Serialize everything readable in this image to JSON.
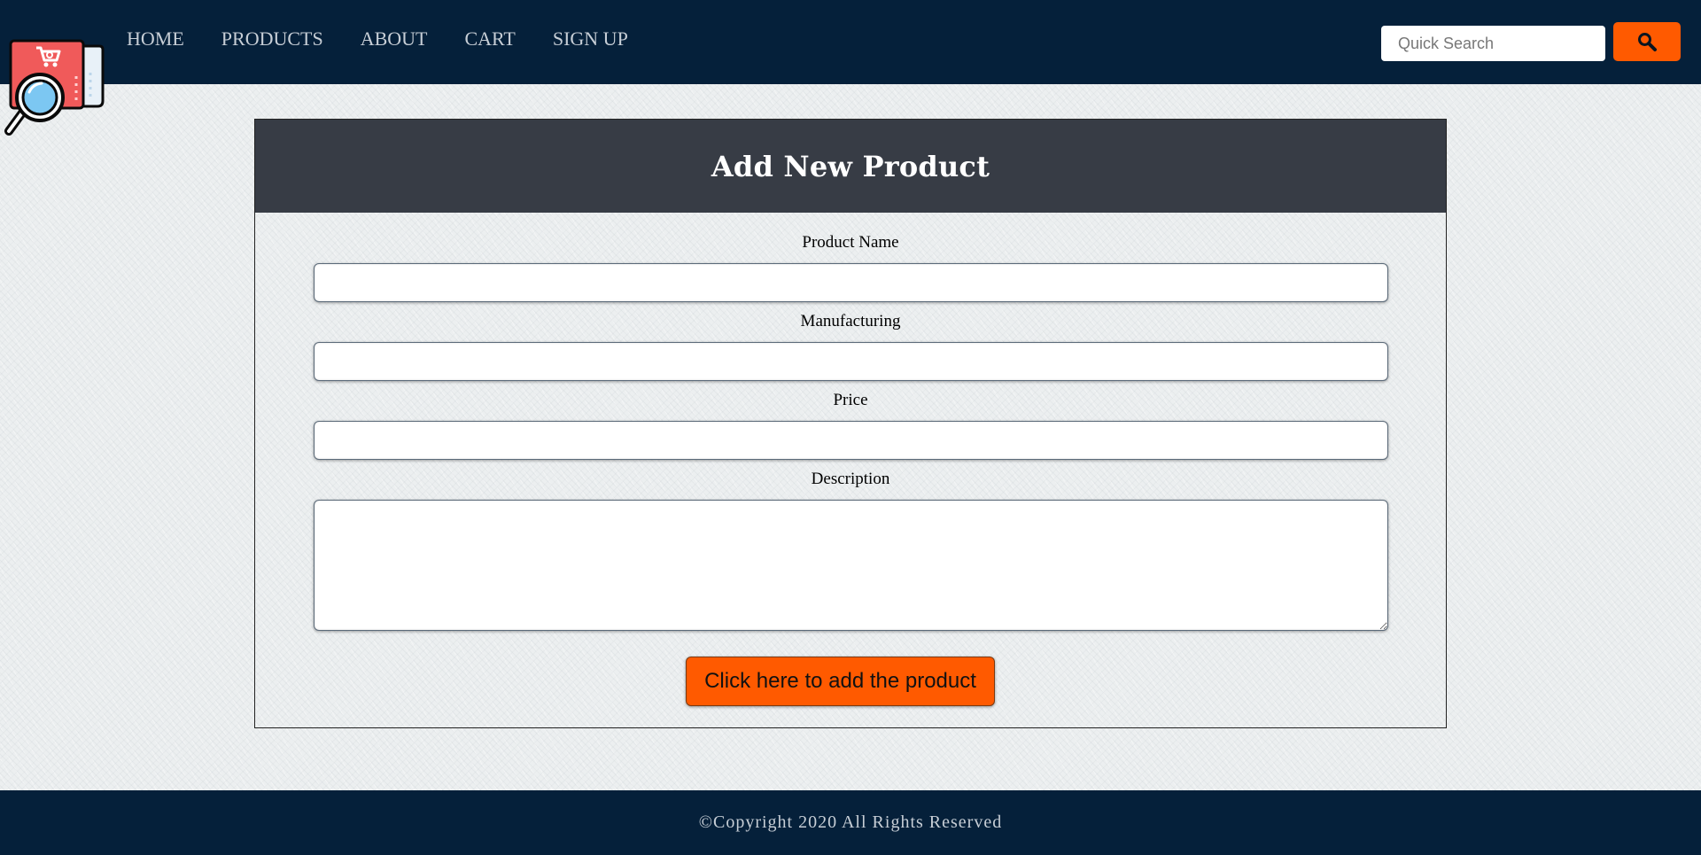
{
  "nav": {
    "items": [
      {
        "label": "HOME"
      },
      {
        "label": "PRODUCTS"
      },
      {
        "label": "ABOUT"
      },
      {
        "label": "CART"
      },
      {
        "label": "SIGN UP"
      }
    ]
  },
  "search": {
    "placeholder": "Quick Search",
    "value": "",
    "icon": "search-icon"
  },
  "form": {
    "title": "Add New Product",
    "fields": [
      {
        "label": "Product Name",
        "value": ""
      },
      {
        "label": "Manufacturing",
        "value": ""
      },
      {
        "label": "Price",
        "value": ""
      },
      {
        "label": "Description",
        "value": ""
      }
    ],
    "submit_label": "Click here to add the product"
  },
  "footer": {
    "copyright": "©Copyright 2020 All Rights Reserved"
  },
  "colors": {
    "navbar": "#05203a",
    "accent": "#ff5a00",
    "card_header": "#373c45",
    "logo_red": "#f05a5a",
    "logo_lens": "#7cc7f2"
  }
}
